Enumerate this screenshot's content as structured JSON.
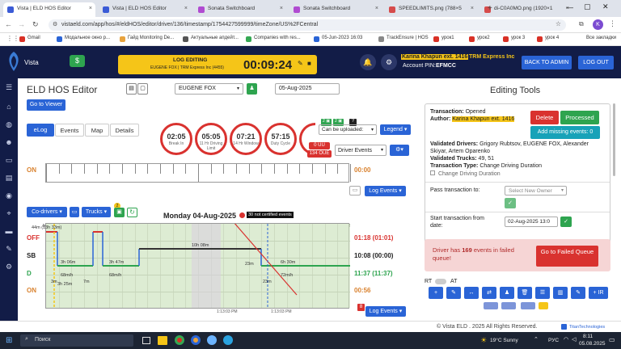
{
  "browser": {
    "tabs": [
      {
        "label": "Vista | ELD HOS Editor",
        "active": true,
        "color": "#3b5bd6"
      },
      {
        "label": "Vista | ELD HOS Editor",
        "active": false,
        "color": "#3b5bd6"
      },
      {
        "label": "Sonata Switchboard",
        "active": false,
        "color": "#b04bd1"
      },
      {
        "label": "Sonata Switchboard",
        "active": false,
        "color": "#b04bd1"
      },
      {
        "label": "SPEEDLIMITS.png (788×5",
        "active": false,
        "color": "#d64b4b"
      },
      {
        "label": "di-C0A0MO.png (1920×1",
        "active": false,
        "color": "#d64b4b"
      }
    ],
    "url": "vistaeld.com/app/hos/#/eldHOS/editor/driver/136/timestamp/1754427599999/timeZone/US%2FCentral",
    "profile_initial": "K",
    "bookmarks": [
      {
        "label": "Gmail",
        "color": "#d93025"
      },
      {
        "label": "Модальное окно р...",
        "color": "#2a64d6"
      },
      {
        "label": "Гайд Monitoring De...",
        "color": "#e8a33d"
      },
      {
        "label": "Актуальные апдейт...",
        "color": "#555"
      },
      {
        "label": "Companies with res...",
        "color": "#34a853"
      },
      {
        "label": "05-Jun-2023 16:03",
        "color": "#2a64d6"
      },
      {
        "label": "TrackEnsure | HOS",
        "color": "#888"
      },
      {
        "label": "урок1",
        "color": "#d93025"
      },
      {
        "label": "урок2",
        "color": "#d93025"
      },
      {
        "label": "урок 3",
        "color": "#d93025"
      },
      {
        "label": "урок 4",
        "color": "#d93025"
      }
    ],
    "all_bookmarks": "Все закладки"
  },
  "header": {
    "logo_text": "Vista",
    "log_editing_title": "LOG EDITING",
    "log_editing_sub": "EUGENE FOX | TRM Express Inc (4455)",
    "timer": "00:09:24",
    "user_name": "Karina Khapun ext. 1416",
    "company": "TRM Express Inc",
    "account_pin_label": "Account PIN:",
    "account_pin": "EFMCC",
    "back_to_admin": "BACK TO ADMIN",
    "log_out": "LOG OUT"
  },
  "editor": {
    "title": "ELD HOS Editor",
    "driver_select": "EUGENE FOX",
    "date": "05-Aug-2025",
    "go_to_viewer": "Go to Viewer",
    "tabs": [
      "eLog",
      "Events",
      "Map",
      "Details"
    ],
    "rings": [
      {
        "value": "02:05",
        "label": "Break In"
      },
      {
        "value": "05:05",
        "label": "11 Hr Driving Limit"
      },
      {
        "value": "07:21",
        "label": "14 Hr Window"
      },
      {
        "value": "57:15",
        "label": "Duty Cycle"
      }
    ],
    "can_be_uploaded": "Can be uploaded:",
    "legend": "Legend",
    "badge_uu": "0 UU",
    "badge_oue": "134 OUE",
    "driver_events": "Driver Events",
    "on_label": "ON",
    "on_total": "00:00",
    "events_button": "Log Events",
    "co_drivers": "Co-drivers",
    "trucks": "Trucks",
    "trucks_count": "2",
    "day_title": "Monday 04-Aug-2025",
    "not_certified": "30 not certified events",
    "hour_labels": [
      "M",
      "1",
      "2",
      "3",
      "4",
      "5",
      "6",
      "7",
      "8",
      "9",
      "10",
      "11",
      "N",
      "1",
      "2",
      "3",
      "4",
      "5",
      "6",
      "7",
      "8",
      "9",
      "10",
      "11",
      "M"
    ],
    "statuses": [
      {
        "label": "OFF",
        "total": "01:18 (01:01)",
        "color": "#d9322f"
      },
      {
        "label": "SB",
        "total": "10:08 (00:00)",
        "color": "#222"
      },
      {
        "label": "D",
        "total": "11:37 (11:37)",
        "color": "#2ea44f"
      },
      {
        "label": "ON",
        "total": "00:56",
        "color": "#d9822f"
      }
    ],
    "segment_labels": [
      "44m (13h 33m)",
      "3h 06m",
      "3h 47m",
      "10h 08m",
      "6h 30m",
      "68m/h",
      "68m/h",
      "72m/h",
      "3h 25m",
      "23m",
      "23m",
      "7m",
      "3m"
    ],
    "bottom_times": [
      "1:13:03 PM",
      "1:13:03 PM"
    ],
    "bottom_badge": "8"
  },
  "panel": {
    "title": "Editing Tools",
    "transaction_label": "Transaction:",
    "transaction_value": "Opened",
    "author_label": "Author:",
    "author_value": "Karina Khapun ext. 1416",
    "delete": "Delete",
    "processed": "Processed",
    "add_missing": "Add missing events: 0",
    "validated_drivers_label": "Validated Drivers:",
    "validated_drivers": "Grigory Rubtsov, EUGENE FOX, Alexander Skiyar, Artem Oparenko",
    "validated_trucks_label": "Validated Trucks:",
    "validated_trucks": "49, 51",
    "transaction_type_label": "Transaction Type:",
    "transaction_type": "Change Driving Duration",
    "checkbox_label": "Change Driving Duration",
    "pass_label": "Pass transaction to:",
    "pass_placeholder": "Select New Owner",
    "start_label": "Start transaction from date:",
    "start_value": "02-Aug-2025 13:0",
    "failed_text_pre": "Driver has ",
    "failed_count": "169",
    "failed_text_post": " events in failed queue!",
    "go_to_failed": "Go to Failed Queue",
    "rt": "RT",
    "at": "AT",
    "tool_icons": [
      "+",
      "✎",
      "↔",
      "⇄",
      "♟",
      "🗑",
      "☰",
      "▥",
      "✎",
      "+ IR"
    ]
  },
  "footer": {
    "copyright": "© Vista ELD . 2025 All Rights Reserved.",
    "powered": "TitanTechnologies"
  },
  "taskbar": {
    "search": "Поиск",
    "weather": "19°C  Sunny",
    "lang": "РУС",
    "time": "8:11",
    "date": "05.08.2025"
  },
  "colors": {
    "navy": "#121c47",
    "blue": "#2a64d6",
    "red": "#d9322f",
    "green": "#2ea44f",
    "yellow": "#f5c518"
  }
}
